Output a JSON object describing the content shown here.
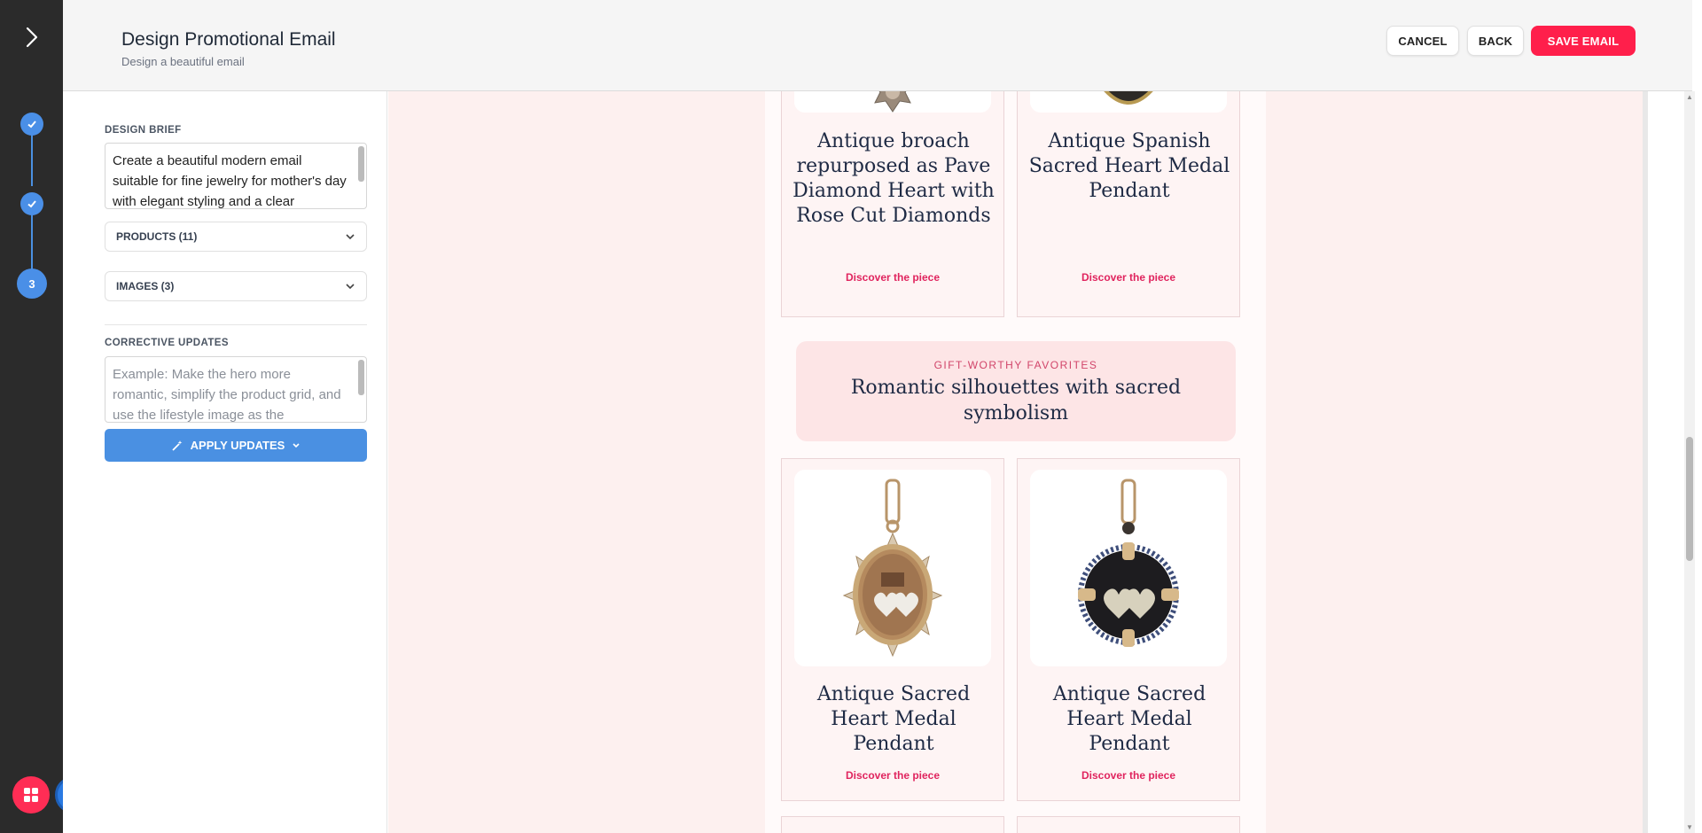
{
  "header": {
    "title": "Design Promotional Email",
    "subtitle": "Design a beautiful email",
    "cancel_label": "CANCEL",
    "back_label": "BACK",
    "save_label": "SAVE EMAIL"
  },
  "stepper": {
    "steps": [
      {
        "state": "complete",
        "icon": "check-icon"
      },
      {
        "state": "complete",
        "icon": "check-icon"
      },
      {
        "state": "current",
        "label": "3"
      }
    ]
  },
  "panel": {
    "design_brief_label": "DESIGN BRIEF",
    "design_brief_value": "Create a beautiful modern email suitable for fine jewelry for mother's day with elegant styling and a clear",
    "products_label": "PRODUCTS (11)",
    "images_label": "IMAGES (3)",
    "corrective_label": "CORRECTIVE UPDATES",
    "corrective_placeholder": "Example: Make the hero more romantic, simplify the product grid, and use the lifestyle image as the",
    "apply_label": "APPLY UPDATES"
  },
  "email": {
    "cta_label": "Discover the piece",
    "top_cards": [
      {
        "title": "Antique broach repurposed as Pave Diamond Heart with Rose Cut Diamonds",
        "cta": "Discover the piece"
      },
      {
        "title": "Antique Spanish Sacred Heart Medal Pendant",
        "cta": "Discover the piece"
      }
    ],
    "banner": {
      "eyebrow": "GIFT-WORTHY FAVORITES",
      "title": "Romantic silhouettes with sacred symbolism"
    },
    "bottom_cards": [
      {
        "title": "Antique Sacred Heart Medal Pendant",
        "cta": "Discover the piece"
      },
      {
        "title": "Antique Sacred Heart Medal Pendant",
        "cta": "Discover the piece"
      }
    ]
  },
  "colors": {
    "accent": "#ff1f4b",
    "primary": "#4a90e2",
    "rail": "#2b2b2b",
    "preview_bg": "#fdf0ef",
    "link": "#e0245e",
    "heading": "#1e2a44"
  }
}
